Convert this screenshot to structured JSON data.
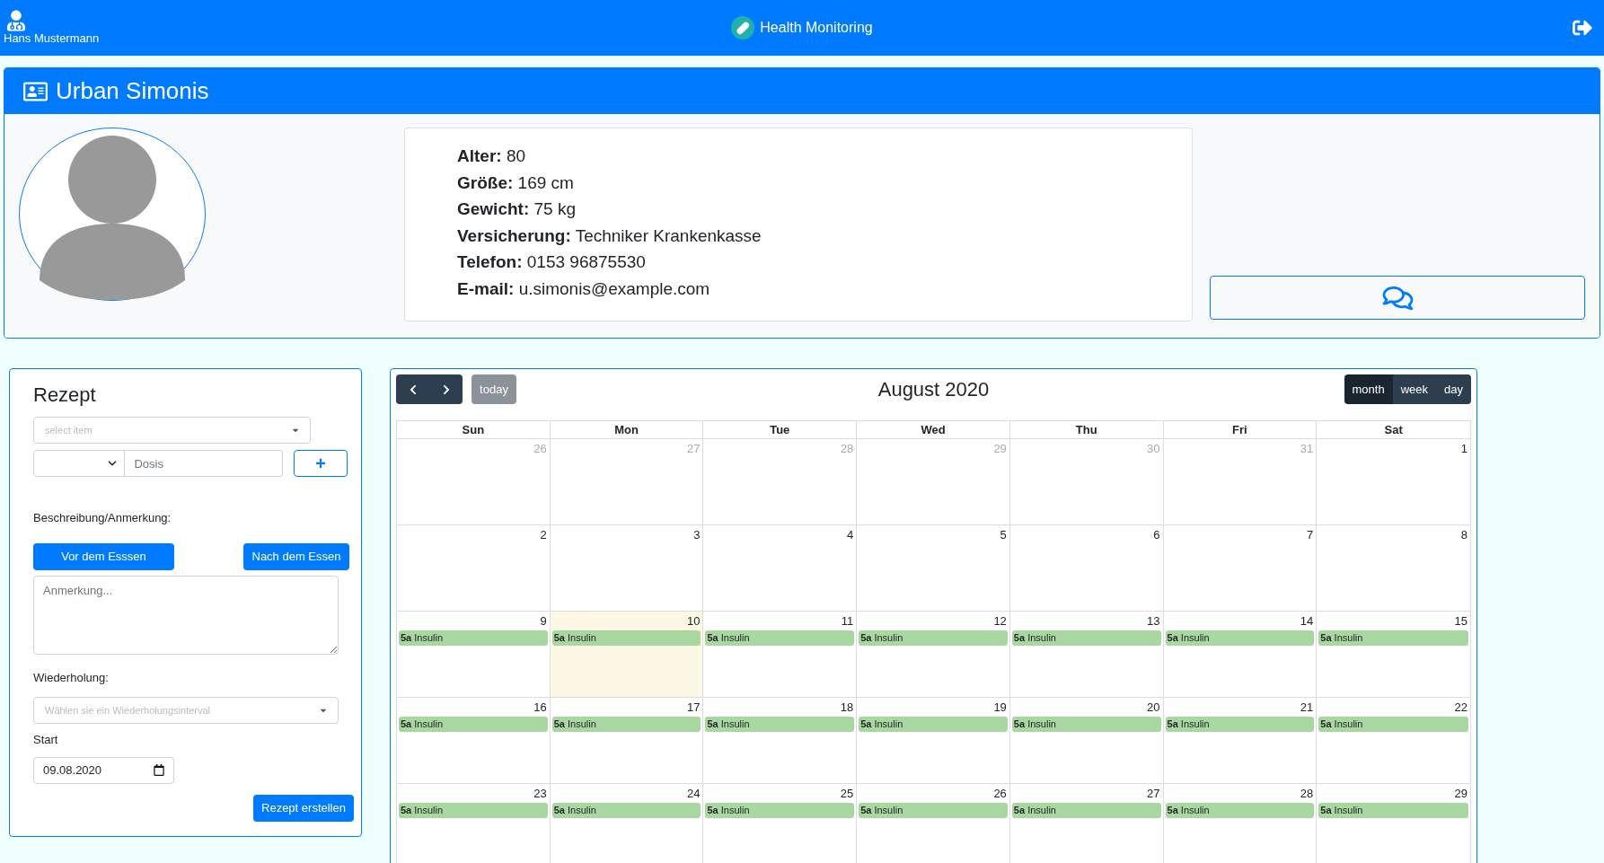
{
  "top_bar": {
    "user_name": "Hans Mustermann",
    "app_title": "Health Monitoring"
  },
  "patient": {
    "name": "Urban Simonis",
    "details": [
      {
        "text": "**Alter:** 80"
      },
      {
        "text": "**Größe:** 169 cm"
      },
      {
        "text": "**Gewicht:** 75 kg"
      },
      {
        "text": "**Versicherung:** Techniker Krankenkasse"
      },
      {
        "text": "**Telefon:** 0153 96875530"
      },
      {
        "text": "**E-mail:** u.simonis@example.com"
      }
    ]
  },
  "prescription": {
    "title": "Rezept",
    "item_select": {
      "placeholder": "select item"
    },
    "dose": {
      "placeholder": "Dosis"
    },
    "add_button": "+",
    "description_label": "Beschreibung/Anmerkung:",
    "before_meal_button": "Vor dem Esssen",
    "after_meal_button": "Nach dem Essen",
    "note": {
      "placeholder": "Anmerkung..."
    },
    "repeat_label": "Wiederholung:",
    "repeat_select": {
      "placeholder": "Wählen sie ein Wiederholungsinterval"
    },
    "start_label": "Start",
    "start_date": {
      "value": "09.08.2020"
    },
    "submit_button": "Rezept erstellen"
  },
  "calendar": {
    "title": "August 2020",
    "today_button": {
      "label": "today",
      "disabled": true
    },
    "views": [
      {
        "label": "month",
        "selected": true
      },
      {
        "label": "week",
        "selected": false
      },
      {
        "label": "day",
        "selected": false
      }
    ],
    "day_names": [
      "Sun",
      "Mon",
      "Tue",
      "Wed",
      "Thu",
      "Fri",
      "Sat"
    ],
    "weeks": [
      {
        "days": [
          {
            "day": "26",
            "other_month": true,
            "today": false
          },
          {
            "day": "27",
            "other_month": true,
            "today": false
          },
          {
            "day": "28",
            "other_month": true,
            "today": false
          },
          {
            "day": "29",
            "other_month": true,
            "today": false
          },
          {
            "day": "30",
            "other_month": true,
            "today": false
          },
          {
            "day": "31",
            "other_month": true,
            "today": false
          },
          {
            "day": "1",
            "other_month": false,
            "today": false
          }
        ]
      },
      {
        "days": [
          {
            "day": "2",
            "other_month": false,
            "today": false
          },
          {
            "day": "3",
            "other_month": false,
            "today": false
          },
          {
            "day": "4",
            "other_month": false,
            "today": false
          },
          {
            "day": "5",
            "other_month": false,
            "today": false
          },
          {
            "day": "6",
            "other_month": false,
            "today": false
          },
          {
            "day": "7",
            "other_month": false,
            "today": false
          },
          {
            "day": "8",
            "other_month": false,
            "today": false
          }
        ]
      },
      {
        "days": [
          {
            "day": "9",
            "other_month": false,
            "today": false,
            "events": [
              "**5a** Insulin"
            ]
          },
          {
            "day": "10",
            "other_month": false,
            "today": true,
            "events": [
              "**5a** Insulin"
            ]
          },
          {
            "day": "11",
            "other_month": false,
            "today": false,
            "events": [
              "**5a** Insulin"
            ]
          },
          {
            "day": "12",
            "other_month": false,
            "today": false,
            "events": [
              "**5a** Insulin"
            ]
          },
          {
            "day": "13",
            "other_month": false,
            "today": false,
            "events": [
              "**5a** Insulin"
            ]
          },
          {
            "day": "14",
            "other_month": false,
            "today": false,
            "events": [
              "**5a** Insulin"
            ]
          },
          {
            "day": "15",
            "other_month": false,
            "today": false,
            "events": [
              "**5a** Insulin"
            ]
          }
        ]
      },
      {
        "days": [
          {
            "day": "16",
            "other_month": false,
            "today": false,
            "events": [
              "**5a** Insulin"
            ]
          },
          {
            "day": "17",
            "other_month": false,
            "today": false,
            "events": [
              "**5a** Insulin"
            ]
          },
          {
            "day": "18",
            "other_month": false,
            "today": false,
            "events": [
              "**5a** Insulin"
            ]
          },
          {
            "day": "19",
            "other_month": false,
            "today": false,
            "events": [
              "**5a** Insulin"
            ]
          },
          {
            "day": "20",
            "other_month": false,
            "today": false,
            "events": [
              "**5a** Insulin"
            ]
          },
          {
            "day": "21",
            "other_month": false,
            "today": false,
            "events": [
              "**5a** Insulin"
            ]
          },
          {
            "day": "22",
            "other_month": false,
            "today": false,
            "events": [
              "**5a** Insulin"
            ]
          }
        ]
      },
      {
        "days": [
          {
            "day": "23",
            "other_month": false,
            "today": false,
            "events": [
              "**5a** Insulin"
            ]
          },
          {
            "day": "24",
            "other_month": false,
            "today": false,
            "events": [
              "**5a** Insulin"
            ]
          },
          {
            "day": "25",
            "other_month": false,
            "today": false,
            "events": [
              "**5a** Insulin"
            ]
          },
          {
            "day": "26",
            "other_month": false,
            "today": false,
            "events": [
              "**5a** Insulin"
            ]
          },
          {
            "day": "27",
            "other_month": false,
            "today": false,
            "events": [
              "**5a** Insulin"
            ]
          },
          {
            "day": "28",
            "other_month": false,
            "today": false,
            "events": [
              "**5a** Insulin"
            ]
          },
          {
            "day": "29",
            "other_month": false,
            "today": false,
            "events": [
              "**5a** Insulin"
            ]
          }
        ]
      }
    ]
  }
}
